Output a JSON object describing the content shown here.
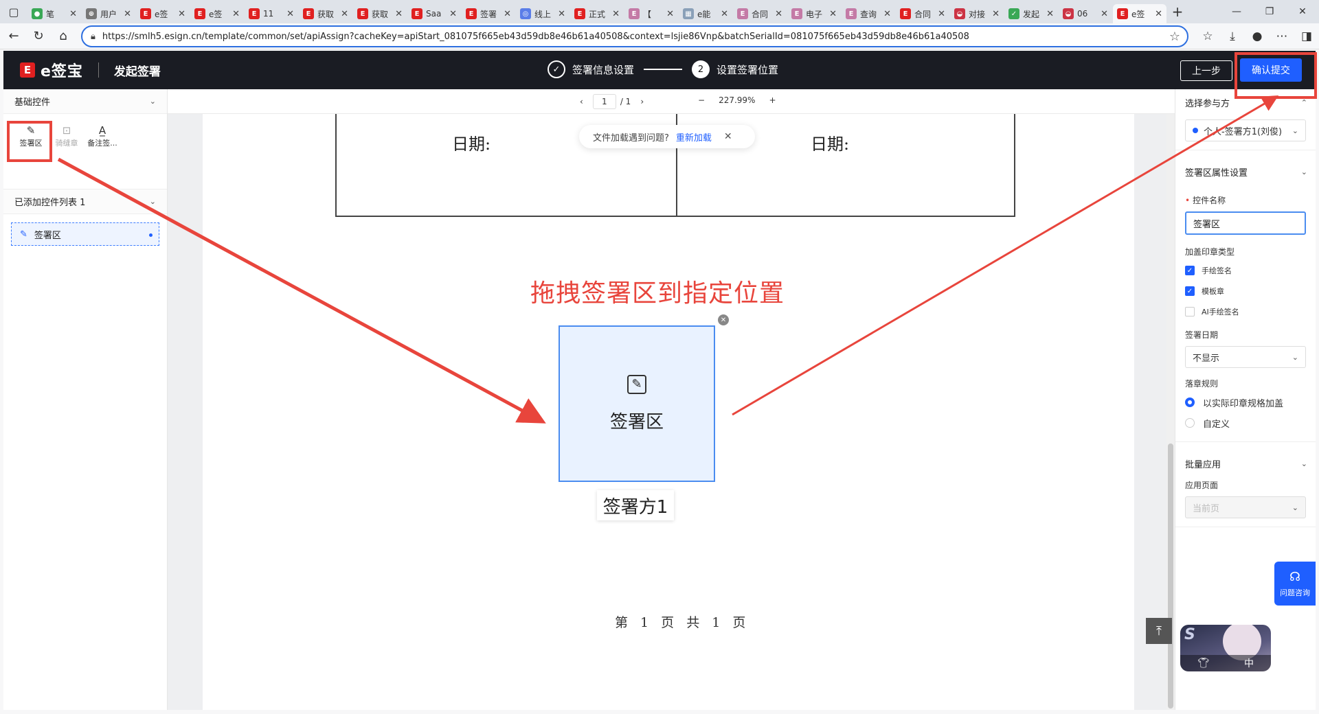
{
  "browser": {
    "tabs": [
      {
        "label": "笔",
        "fav_color": "#3aa856",
        "fav_text": "●"
      },
      {
        "label": "用户",
        "fav_color": "#777777",
        "fav_text": "⊕"
      },
      {
        "label": "e签",
        "fav_color": "#e02020",
        "fav_text": "E"
      },
      {
        "label": "e签",
        "fav_color": "#e02020",
        "fav_text": "E"
      },
      {
        "label": "11",
        "fav_color": "#e02020",
        "fav_text": "E"
      },
      {
        "label": "获取",
        "fav_color": "#e02020",
        "fav_text": "E"
      },
      {
        "label": "获取",
        "fav_color": "#e02020",
        "fav_text": "E"
      },
      {
        "label": "Saa",
        "fav_color": "#e02020",
        "fav_text": "E"
      },
      {
        "label": "签署",
        "fav_color": "#e02020",
        "fav_text": "E"
      },
      {
        "label": "线上",
        "fav_color": "#5a7de8",
        "fav_text": "◎"
      },
      {
        "label": "正式",
        "fav_color": "#e02020",
        "fav_text": "E"
      },
      {
        "label": "【",
        "fav_color": "#c47aa6",
        "fav_text": "E"
      },
      {
        "label": "e能",
        "fav_color": "#8aa0b8",
        "fav_text": "▦"
      },
      {
        "label": "合同",
        "fav_color": "#c47aa6",
        "fav_text": "E"
      },
      {
        "label": "电子",
        "fav_color": "#c47aa6",
        "fav_text": "E"
      },
      {
        "label": "查询",
        "fav_color": "#c47aa6",
        "fav_text": "E"
      },
      {
        "label": "合同",
        "fav_color": "#e02020",
        "fav_text": "E"
      },
      {
        "label": "对接",
        "fav_color": "#cc3344",
        "fav_text": "◒"
      },
      {
        "label": "发起",
        "fav_color": "#3aa856",
        "fav_text": "✓"
      },
      {
        "label": "06",
        "fav_color": "#cc3344",
        "fav_text": "◒"
      },
      {
        "label": "e签",
        "fav_color": "#e02020",
        "fav_text": "E",
        "active": true
      }
    ],
    "url": "https://smlh5.esign.cn/template/common/set/apiAssign?cacheKey=apiStart_081075f665eb43d59db8e46b61a40508&context=lsjie86Vnp&batchSerialId=081075f665eb43d59db8e46b61a40508"
  },
  "header": {
    "logo_text": "e签宝",
    "title": "发起签署",
    "step1_label": "签署信息设置",
    "step2_number": "2",
    "step2_label": "设置签署位置",
    "prev_label": "上一步",
    "submit_label": "确认提交"
  },
  "left": {
    "basic_title": "基础控件",
    "controls": [
      {
        "label": "签署区",
        "icon": "✎",
        "enabled": true
      },
      {
        "label": "骑缝章",
        "icon": "⊡",
        "enabled": false
      },
      {
        "label": "备注签...",
        "icon": "A̲",
        "enabled": true
      }
    ],
    "added_title": "已添加控件列表 1",
    "added_item": "签署区"
  },
  "toolbar": {
    "page_current": "1",
    "page_total": "/ 1",
    "zoom": "227.99%"
  },
  "doc": {
    "date_left": "日期:",
    "date_right": "日期:",
    "toast_text": "文件加载遇到问题?",
    "toast_link": "重新加载",
    "instruction": "拖拽签署区到指定位置",
    "sigbox_label": "签署区",
    "signer_tag": "签署方1",
    "footer": "第 1 页 共 1 页"
  },
  "right": {
    "party_title": "选择参与方",
    "party_value": "个人-签署方1(刘俊)",
    "props_title": "签署区属性设置",
    "name_label": "控件名称",
    "name_value": "签署区",
    "seal_type_label": "加盖印章类型",
    "seal_types": [
      {
        "label": "手绘签名",
        "checked": true
      },
      {
        "label": "模板章",
        "checked": true
      },
      {
        "label": "AI手绘签名",
        "checked": false
      }
    ],
    "date_label": "签署日期",
    "date_value": "不显示",
    "rule_label": "落章规则",
    "rules": [
      {
        "label": "以实际印章规格加盖",
        "selected": true
      },
      {
        "label": "自定义",
        "selected": false
      }
    ],
    "batch_title": "批量应用",
    "apply_label": "应用页面",
    "apply_value": "当前页",
    "help_label": "问题咨询"
  },
  "ime": {
    "mode": "中"
  },
  "colors": {
    "accent": "#1f5fff",
    "annotation": "#e8453c",
    "header_bg": "#1a1c23"
  }
}
